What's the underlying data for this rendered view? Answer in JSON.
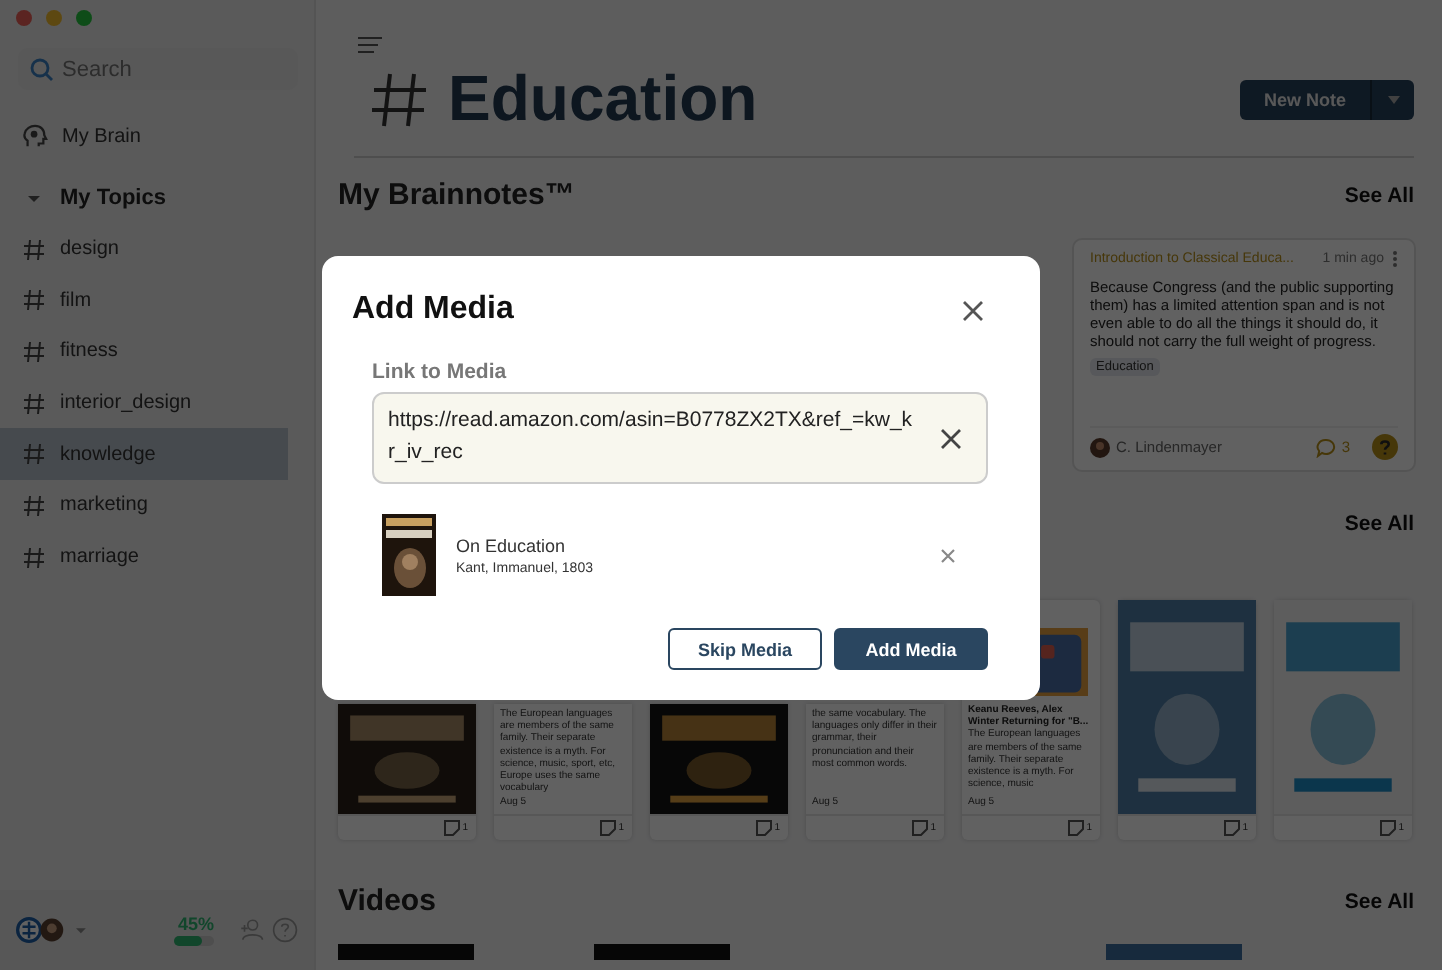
{
  "sidebar": {
    "search": {
      "placeholder": "Search"
    },
    "my_brain": "My Brain",
    "topics_header": {
      "label": "My Topics",
      "expanded": true
    },
    "topics": [
      {
        "label": "design",
        "selected": false
      },
      {
        "label": "film",
        "selected": false
      },
      {
        "label": "fitness",
        "selected": false
      },
      {
        "label": "interior_design",
        "selected": false
      },
      {
        "label": "knowledge",
        "selected": true
      },
      {
        "label": "marketing",
        "selected": false
      },
      {
        "label": "marriage",
        "selected": false
      }
    ],
    "footer": {
      "storage": "45%",
      "level": 0.7
    }
  },
  "header": {
    "title": "Education",
    "new_note": "New Note"
  },
  "brainnotes": {
    "title": "My Brainnotes™",
    "see_all": "See All",
    "card": {
      "title": "Introduction to Classical Educa...",
      "time": "1 min ago",
      "body": "Because Congress (and the public supporting them) has a limited attention span and is not even able to do all the things it should do, it should not carry the full weight of progress.",
      "tag": "Education",
      "author": "C. Lindenmayer",
      "comments": "3"
    }
  },
  "media": {
    "see_all": "See All",
    "cards": [
      {
        "kind": "picture",
        "count": "1"
      },
      {
        "kind": "text",
        "body": "The European languages are members of the same family. Their separate existence is a myth. For science, music, sport, etc, Europe uses the same vocabulary",
        "date": "Aug 5",
        "count": "1"
      },
      {
        "kind": "picture",
        "count": "1"
      },
      {
        "kind": "text",
        "body": "the same vocabulary. The languages only differ in their grammar, their pronunciation and their most common words.",
        "date": "Aug 5",
        "count": "1"
      },
      {
        "kind": "article",
        "title": "Keanu Reeves, Alex Winter Returning for \"B...",
        "body": "The European languages are members of the same family. Their separate existence is a myth. For science, music",
        "date": "Aug 5",
        "count": "1"
      },
      {
        "kind": "picture",
        "count": "1"
      },
      {
        "kind": "picture",
        "count": "1"
      }
    ]
  },
  "videos": {
    "title": "Videos",
    "see_all": "See All"
  },
  "modal": {
    "title": "Add Media",
    "field_label": "Link to Media",
    "link_value": "https://read.amazon.com/asin=B0778ZX2TX&ref_=kw_kr_iv_rec",
    "result": {
      "title": "On Education",
      "subtitle": "Kant, Immanuel, 1803"
    },
    "buttons": [
      {
        "label": "Skip Media",
        "kind": "secondary"
      },
      {
        "label": "Add Media",
        "kind": "primary"
      }
    ]
  }
}
